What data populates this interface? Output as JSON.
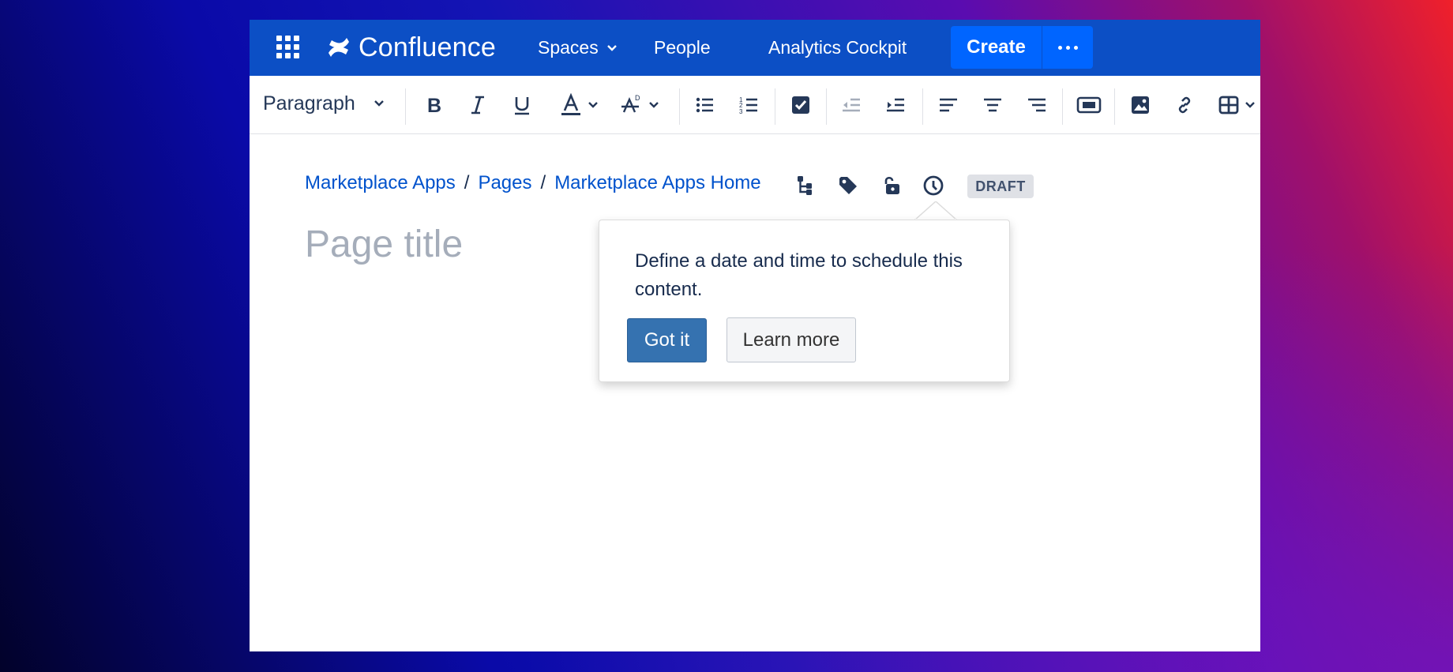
{
  "nav": {
    "logo_text": "Confluence",
    "spaces_label": "Spaces",
    "people_label": "People",
    "analytics_label": "Analytics Cockpit",
    "create_label": "Create",
    "icons": [
      "apps-grid-icon",
      "confluence-logo-icon",
      "chevron-down-icon",
      "more-icon"
    ]
  },
  "toolbar": {
    "paragraph_style": "Paragraph",
    "buttons": [
      "bold",
      "italic",
      "underline",
      "text-color",
      "text-style",
      "bullet-list",
      "numbered-list",
      "task-list",
      "outdent",
      "indent",
      "align-left",
      "align-center",
      "align-right",
      "page-layout",
      "insert-image",
      "insert-link",
      "insert-table"
    ]
  },
  "breadcrumbs": {
    "items": [
      "Marketplace Apps",
      "Pages",
      "Marketplace Apps Home"
    ],
    "separator": "/"
  },
  "page_meta": {
    "icons": [
      "page-tree-icon",
      "label-icon",
      "restrictions-icon",
      "schedule-clock-icon"
    ],
    "status_badge": "DRAFT"
  },
  "editor": {
    "title_placeholder": "Page title"
  },
  "popover": {
    "message": "Define a date and time to schedule this content.",
    "primary_label": "Got it",
    "secondary_label": "Learn more"
  },
  "colors": {
    "nav_bg": "#0c4fc5",
    "create_bg": "#0065ff",
    "link": "#0052cc",
    "primary_button": "#3572b0"
  }
}
